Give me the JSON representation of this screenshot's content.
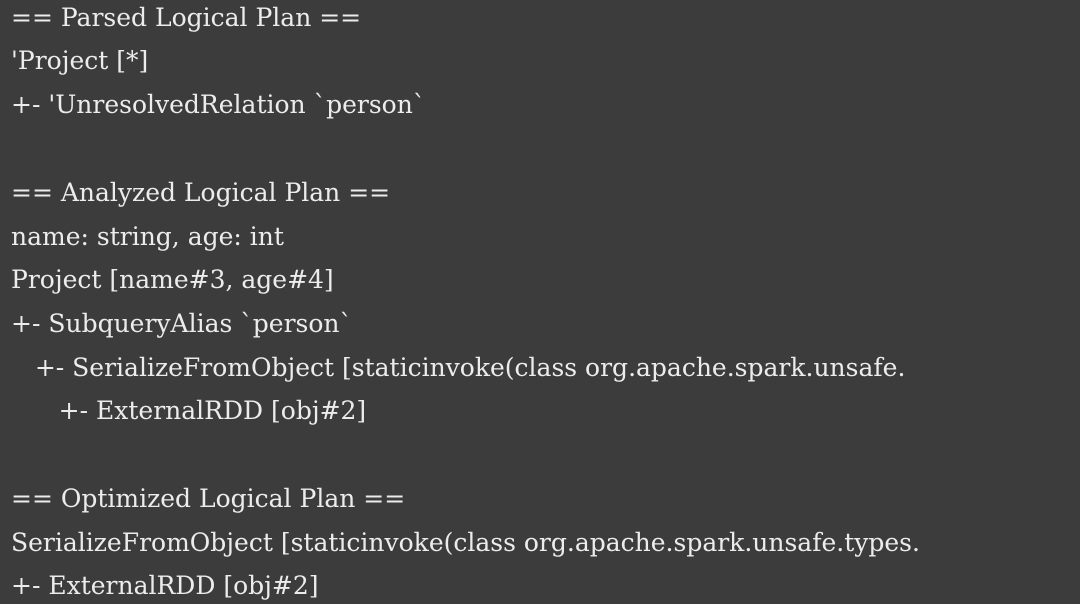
{
  "terminal": {
    "lines": [
      "== Parsed Logical Plan ==",
      "'Project [*]",
      "+- 'UnresolvedRelation `person`",
      "",
      "== Analyzed Logical Plan ==",
      "name: string, age: int",
      "Project [name#3, age#4]",
      "+- SubqueryAlias `person`",
      "   +- SerializeFromObject [staticinvoke(class org.apache.spark.unsafe.",
      "      +- ExternalRDD [obj#2]",
      "",
      "== Optimized Logical Plan ==",
      "SerializeFromObject [staticinvoke(class org.apache.spark.unsafe.types.",
      "+- ExternalRDD [obj#2]"
    ]
  }
}
